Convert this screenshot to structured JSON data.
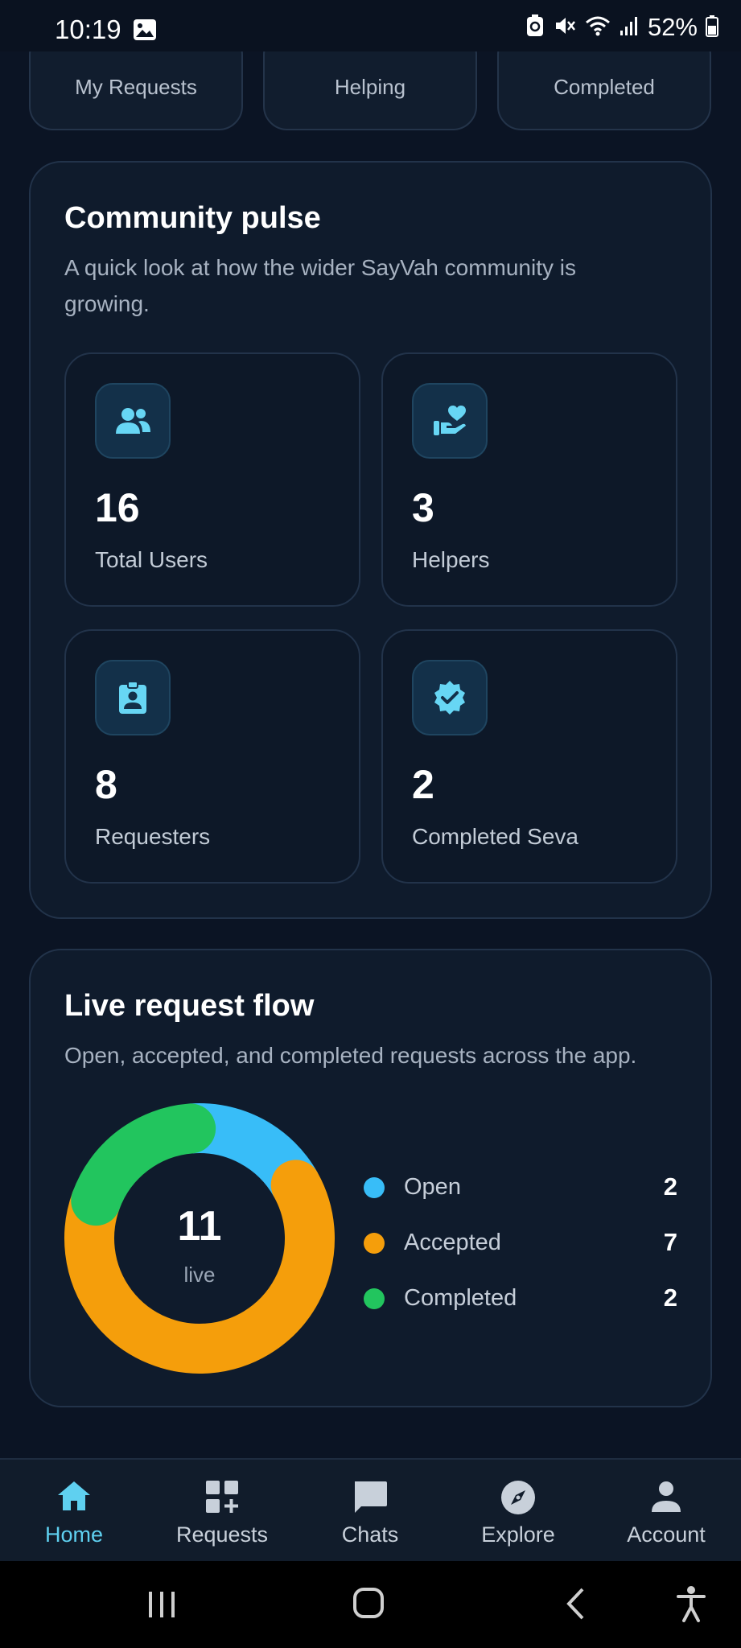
{
  "status_bar": {
    "time": "10:19",
    "battery": "52%"
  },
  "top_stats": [
    {
      "label": "My Requests"
    },
    {
      "label": "Helping"
    },
    {
      "label": "Completed"
    }
  ],
  "community": {
    "title": "Community pulse",
    "subtitle_line1": "A quick look at how the wider SayVah community is",
    "subtitle_line2": "growing.",
    "stats": [
      {
        "value": "16",
        "label": "Total Users",
        "icon": "users-icon"
      },
      {
        "value": "3",
        "label": "Helpers",
        "icon": "helping-hand-heart-icon"
      },
      {
        "value": "8",
        "label": "Requesters",
        "icon": "badge-person-icon"
      },
      {
        "value": "2",
        "label": "Completed Seva",
        "icon": "verified-badge-icon"
      }
    ]
  },
  "flow": {
    "title": "Live request flow",
    "subtitle": "Open, accepted, and completed requests across the app.",
    "total": "11",
    "total_label": "live",
    "legend": [
      {
        "label": "Open",
        "value": "2",
        "color": "#38bdf8"
      },
      {
        "label": "Accepted",
        "value": "7",
        "color": "#f59e0b"
      },
      {
        "label": "Completed",
        "value": "2",
        "color": "#22c55e"
      }
    ]
  },
  "chart_data": {
    "type": "pie",
    "categories": [
      "Open",
      "Accepted",
      "Completed"
    ],
    "values": [
      2,
      7,
      2
    ],
    "colors": [
      "#38bdf8",
      "#f59e0b",
      "#22c55e"
    ],
    "title": "",
    "center_value": 11,
    "center_label": "live"
  },
  "nav": [
    {
      "label": "Home",
      "icon": "home-icon",
      "active": true
    },
    {
      "label": "Requests",
      "icon": "grid-add-icon",
      "active": false
    },
    {
      "label": "Chats",
      "icon": "chat-icon",
      "active": false
    },
    {
      "label": "Explore",
      "icon": "compass-icon",
      "active": false
    },
    {
      "label": "Account",
      "icon": "person-icon",
      "active": false
    }
  ]
}
